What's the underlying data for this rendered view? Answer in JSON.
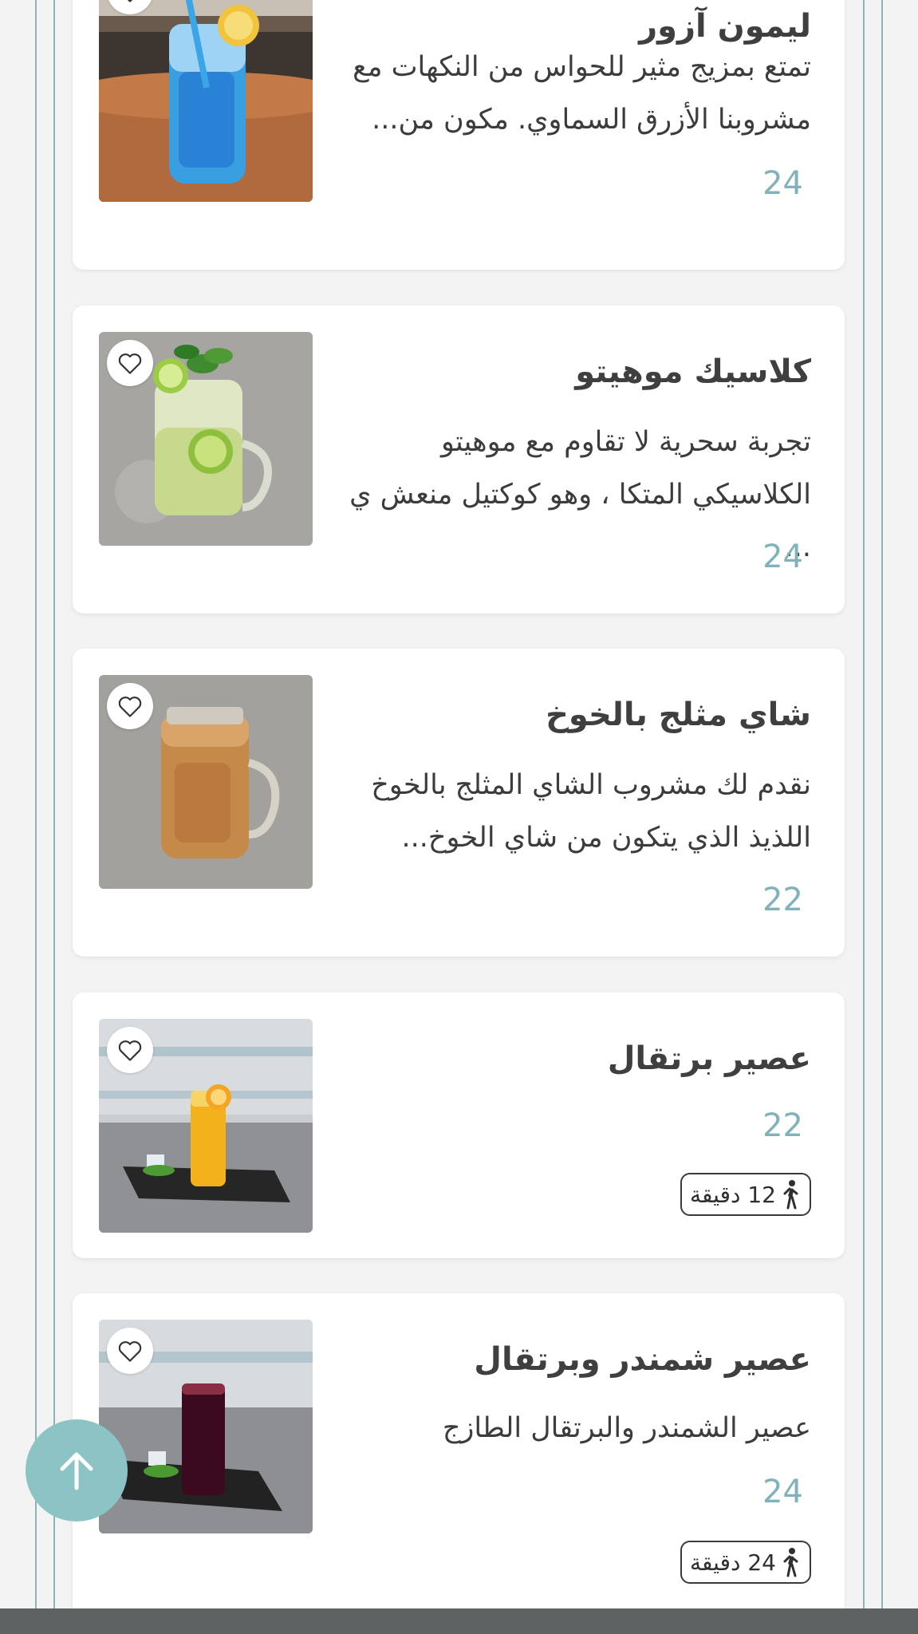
{
  "menu": {
    "items": [
      {
        "title": "ليمون آزور",
        "description": "تمتع بمزيج مثير للحواس من النكهات مع مشروبنا الأزرق السماوي. مكون من...",
        "price": "24"
      },
      {
        "title": "كلاسيك موهيتو",
        "description": "تجربة سحرية لا تقاوم مع موهيتو الكلاسيكي المتكا ، وهو كوكتيل منعش ي ...",
        "price": "24"
      },
      {
        "title": "شاي مثلج بالخوخ",
        "description": "نقدم لك مشروب الشاي المثلج بالخوخ اللذيذ الذي يتكون من شاي الخوخ...",
        "price": "22"
      },
      {
        "title": "عصير برتقال",
        "price": "22",
        "prep_time": "12 دقيقة"
      },
      {
        "title": "عصير شمندر وبرتقال",
        "description": "عصير الشمندر والبرتقال الطازج",
        "price": "24",
        "prep_time": "24 دقيقة"
      }
    ]
  },
  "icons": {
    "favorite": "heart-outline-icon",
    "prep_time": "walking-person-icon",
    "scroll_top": "arrow-up-icon"
  },
  "colors": {
    "accent": "#7fb2bb",
    "scroll_button": "#8cc3c4",
    "frame_line": "#8fb1b9",
    "title_text": "#3f3f3f",
    "card_background": "#ffffff",
    "page_background": "#f3f3f3"
  }
}
